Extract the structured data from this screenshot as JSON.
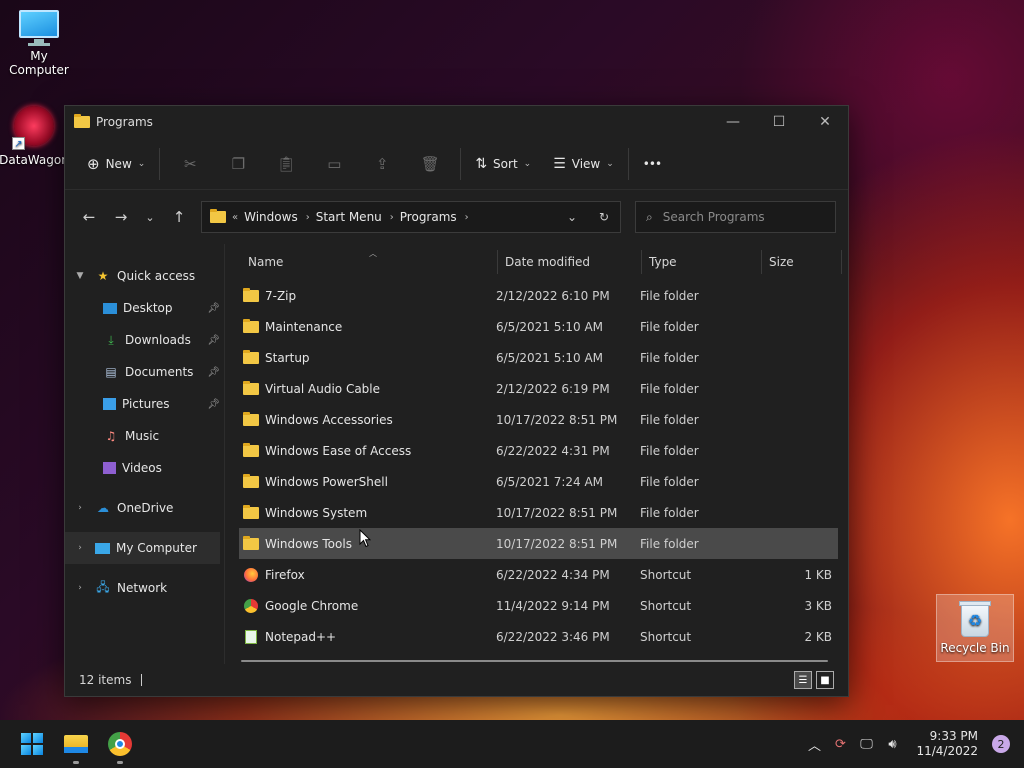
{
  "desktop": {
    "icons": [
      {
        "label": "My Computer"
      },
      {
        "label": "DataWagon"
      },
      {
        "label": "Recycle Bin"
      }
    ]
  },
  "window": {
    "title": "Programs",
    "controls": {
      "minimize": "—",
      "maximize": "☐",
      "close": "✕"
    }
  },
  "toolbar": {
    "new_label": "New",
    "sort_label": "Sort",
    "view_label": "View",
    "more_label": "•••"
  },
  "address": {
    "crumbs": [
      "Windows",
      "Start Menu",
      "Programs"
    ]
  },
  "search": {
    "placeholder": "Search Programs"
  },
  "sidebar": {
    "items": [
      {
        "label": "Quick access"
      },
      {
        "label": "Desktop"
      },
      {
        "label": "Downloads"
      },
      {
        "label": "Documents"
      },
      {
        "label": "Pictures"
      },
      {
        "label": "Music"
      },
      {
        "label": "Videos"
      },
      {
        "label": "OneDrive"
      },
      {
        "label": "My Computer"
      },
      {
        "label": "Network"
      }
    ]
  },
  "columns": {
    "name": "Name",
    "date": "Date modified",
    "type": "Type",
    "size": "Size"
  },
  "files": [
    {
      "name": "7-Zip",
      "date": "2/12/2022 6:10 PM",
      "type": "File folder",
      "size": ""
    },
    {
      "name": "Maintenance",
      "date": "6/5/2021 5:10 AM",
      "type": "File folder",
      "size": ""
    },
    {
      "name": "Startup",
      "date": "6/5/2021 5:10 AM",
      "type": "File folder",
      "size": ""
    },
    {
      "name": "Virtual Audio Cable",
      "date": "2/12/2022 6:19 PM",
      "type": "File folder",
      "size": ""
    },
    {
      "name": "Windows Accessories",
      "date": "10/17/2022 8:51 PM",
      "type": "File folder",
      "size": ""
    },
    {
      "name": "Windows Ease of Access",
      "date": "6/22/2022 4:31 PM",
      "type": "File folder",
      "size": ""
    },
    {
      "name": "Windows PowerShell",
      "date": "6/5/2021 7:24 AM",
      "type": "File folder",
      "size": ""
    },
    {
      "name": "Windows System",
      "date": "10/17/2022 8:51 PM",
      "type": "File folder",
      "size": ""
    },
    {
      "name": "Windows Tools",
      "date": "10/17/2022 8:51 PM",
      "type": "File folder",
      "size": ""
    },
    {
      "name": "Firefox",
      "date": "6/22/2022 4:34 PM",
      "type": "Shortcut",
      "size": "1 KB"
    },
    {
      "name": "Google Chrome",
      "date": "11/4/2022 9:14 PM",
      "type": "Shortcut",
      "size": "3 KB"
    },
    {
      "name": "Notepad++",
      "date": "6/22/2022 3:46 PM",
      "type": "Shortcut",
      "size": "2 KB"
    }
  ],
  "status": {
    "item_count": "12 items"
  },
  "taskbar": {
    "time": "9:33 PM",
    "date": "11/4/2022",
    "notification_count": "2"
  }
}
